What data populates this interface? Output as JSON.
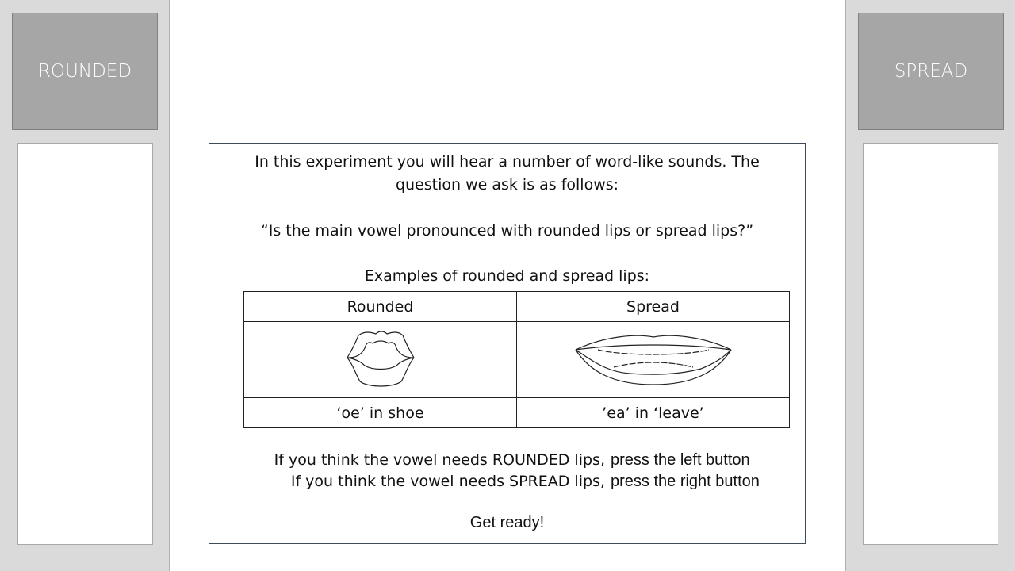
{
  "left_button": {
    "label": "ROUNDED"
  },
  "right_button": {
    "label": "SPREAD"
  },
  "instructions": {
    "line1": "In this experiment you will hear a number of word-like sounds. The",
    "line2": "question we ask is as follows:",
    "question": "“Is the main vowel pronounced with rounded lips or spread lips?”",
    "examples_heading": "Examples of rounded and spread lips:",
    "table": {
      "headers": [
        "Rounded",
        "Spread"
      ],
      "examples": [
        "‘oe’ in shoe",
        "’ea’ in ‘leave’"
      ]
    },
    "rounded_prefix": "If you think the vowel needs ROUNDED lips,",
    "rounded_action": "press the left button",
    "spread_prefix": "If you think the vowel needs SPREAD lips,",
    "spread_action": "press the right button",
    "ready": "Get ready!"
  }
}
